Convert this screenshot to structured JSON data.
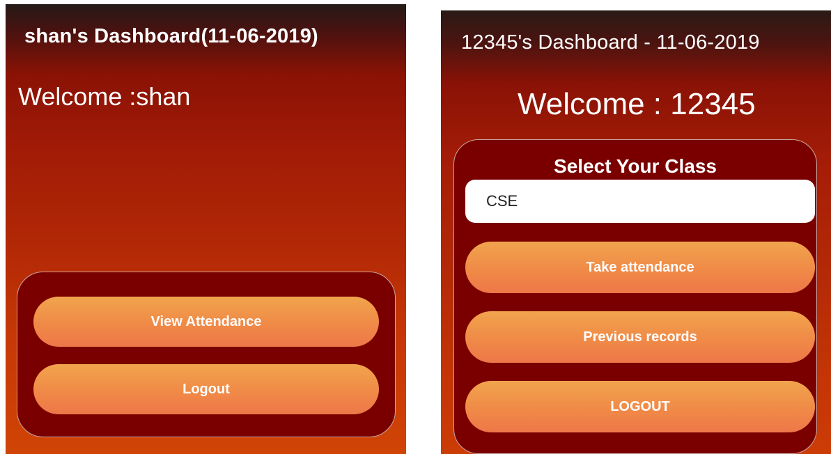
{
  "left_screen": {
    "title": "shan's Dashboard(11-06-2019)",
    "welcome": "Welcome :shan",
    "buttons": {
      "view_attendance": "View Attendance",
      "logout": "Logout"
    }
  },
  "right_screen": {
    "title": "12345's Dashboard  - 11-06-2019",
    "welcome": "Welcome : 12345",
    "select_heading": "Select Your Class",
    "class_value": "CSE",
    "buttons": {
      "take_attendance": "Take attendance",
      "previous_records": "Previous records",
      "logout": "LOGOUT"
    }
  },
  "colors": {
    "panel_background": "#7a0000",
    "button_gradient_top": "#f1a44d",
    "button_gradient_bottom": "#ee7748",
    "gradient_dark": "#251a17",
    "gradient_light": "#d04406"
  }
}
